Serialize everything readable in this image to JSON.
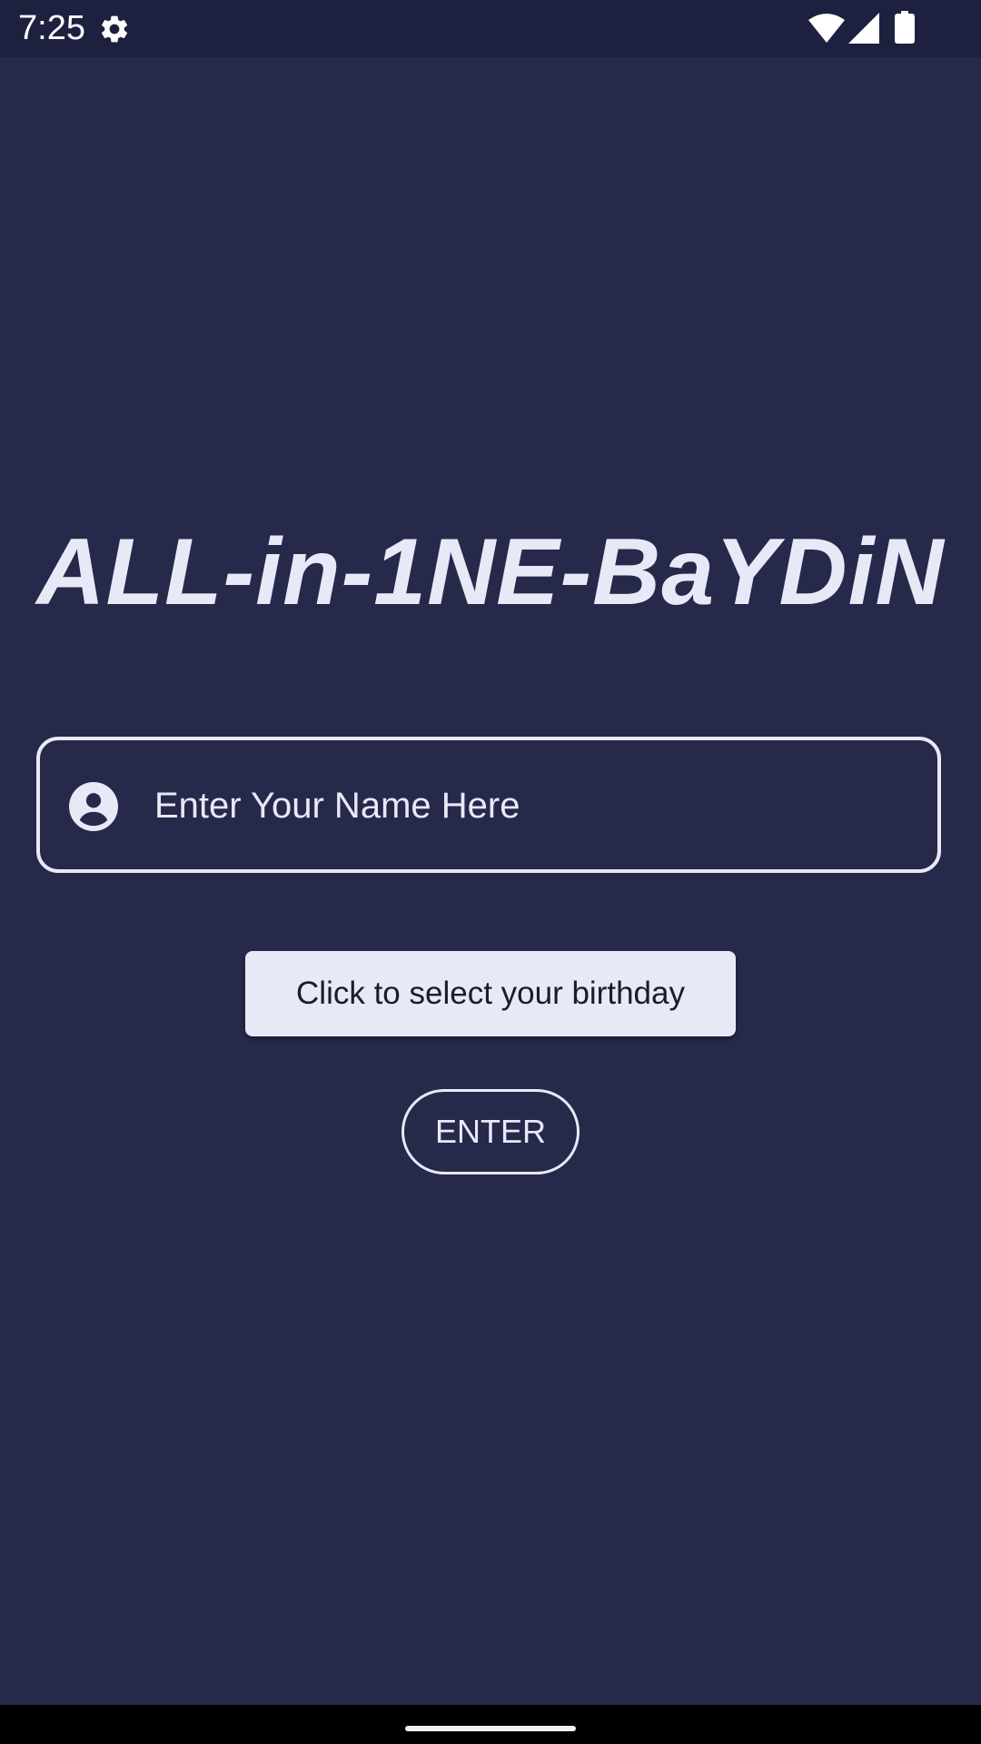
{
  "status_bar": {
    "time": "7:25",
    "icons": [
      "gear-icon",
      "wifi-icon",
      "signal-icon",
      "battery-icon"
    ]
  },
  "app": {
    "title": "ALL-in-1NE-BaYDiN"
  },
  "form": {
    "name_placeholder": "Enter Your Name Here",
    "name_value": "",
    "name_icon": "person-icon",
    "birthday_button_label": "Click to select your birthday",
    "enter_button_label": "ENTER"
  },
  "colors": {
    "background": "#26294a",
    "status_bar": "#1e2040",
    "foreground": "#e8e9f7",
    "nav_bar": "#000000"
  }
}
